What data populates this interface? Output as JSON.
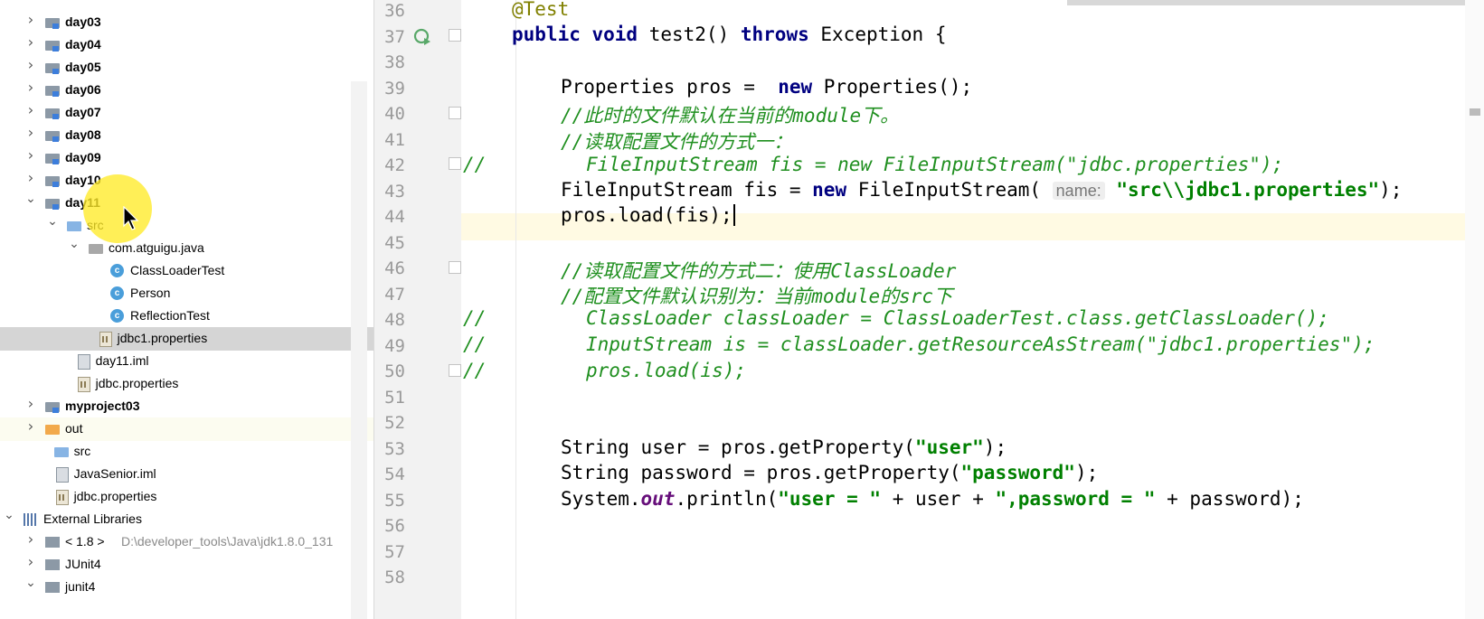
{
  "tree": [
    {
      "label": "day03",
      "bold": true,
      "indent": 0,
      "arrow": "right",
      "icon": "module-folder-icon"
    },
    {
      "label": "day04",
      "bold": true,
      "indent": 0,
      "arrow": "right",
      "icon": "module-folder-icon"
    },
    {
      "label": "day05",
      "bold": true,
      "indent": 0,
      "arrow": "right",
      "icon": "module-folder-icon"
    },
    {
      "label": "day06",
      "bold": true,
      "indent": 0,
      "arrow": "right",
      "icon": "module-folder-icon"
    },
    {
      "label": "day07",
      "bold": true,
      "indent": 0,
      "arrow": "right",
      "icon": "module-folder-icon"
    },
    {
      "label": "day08",
      "bold": true,
      "indent": 0,
      "arrow": "right",
      "icon": "module-folder-icon"
    },
    {
      "label": "day09",
      "bold": true,
      "indent": 0,
      "arrow": "right",
      "icon": "module-folder-icon"
    },
    {
      "label": "day10",
      "bold": true,
      "indent": 0,
      "arrow": "right",
      "icon": "module-folder-icon"
    },
    {
      "label": "day11",
      "bold": true,
      "indent": 0,
      "arrow": "down",
      "icon": "module-folder-icon"
    },
    {
      "label": "src",
      "bold": false,
      "indent": 1,
      "arrow": "down",
      "icon": "source-folder-icon"
    },
    {
      "label": "com.atguigu.java",
      "bold": false,
      "indent": 2,
      "arrow": "down",
      "icon": "package-icon"
    },
    {
      "label": "ClassLoaderTest",
      "bold": false,
      "indent": 3,
      "arrow": "",
      "icon": "java-class-icon"
    },
    {
      "label": "Person",
      "bold": false,
      "indent": 3,
      "arrow": "",
      "icon": "java-class-icon"
    },
    {
      "label": "ReflectionTest",
      "bold": false,
      "indent": 3,
      "arrow": "",
      "icon": "java-class-icon"
    },
    {
      "label": "jdbc1.properties",
      "bold": false,
      "indent": 2.4,
      "arrow": "",
      "icon": "properties-file-icon",
      "selected": true
    },
    {
      "label": "day11.iml",
      "bold": false,
      "indent": 1.4,
      "arrow": "",
      "icon": "iml-file-icon"
    },
    {
      "label": "jdbc.properties",
      "bold": false,
      "indent": 1.4,
      "arrow": "",
      "icon": "properties-file-icon"
    },
    {
      "label": "myproject03",
      "bold": true,
      "indent": 0,
      "arrow": "right",
      "icon": "module-folder-icon"
    },
    {
      "label": "out",
      "bold": false,
      "indent": 0,
      "arrow": "right",
      "icon": "excluded-folder-icon",
      "highlight": true
    },
    {
      "label": "src",
      "bold": false,
      "indent": 0.4,
      "arrow": "",
      "icon": "folder-icon"
    },
    {
      "label": "JavaSenior.iml",
      "bold": false,
      "indent": 0.4,
      "arrow": "",
      "icon": "iml-file-icon"
    },
    {
      "label": "jdbc.properties",
      "bold": false,
      "indent": 0.4,
      "arrow": "",
      "icon": "properties-file-icon"
    },
    {
      "label": "External Libraries",
      "bold": false,
      "indent": -1,
      "arrow": "down",
      "icon": "library-icon"
    },
    {
      "label": "< 1.8 >",
      "bold": false,
      "indent": 0,
      "arrow": "right",
      "icon": "jdk-icon",
      "hint": "D:\\developer_tools\\Java\\jdk1.8.0_131"
    },
    {
      "label": "JUnit4",
      "bold": false,
      "indent": 0,
      "arrow": "right",
      "icon": "jdk-icon"
    },
    {
      "label": "junit4",
      "bold": false,
      "indent": 0,
      "arrow": "down",
      "icon": "jdk-icon"
    }
  ],
  "editor": {
    "line_numbers": [
      "36",
      "37",
      "38",
      "39",
      "40",
      "41",
      "42",
      "43",
      "44",
      "45",
      "46",
      "47",
      "48",
      "49",
      "50",
      "51",
      "52",
      "53",
      "54",
      "55",
      "56",
      "57",
      "58"
    ],
    "gutter_comment": "//",
    "lines": {
      "l36_anno": "@Test",
      "l37_kw1": "public void ",
      "l37_name": "test2() ",
      "l37_kw2": "throws ",
      "l37_rest": "Exception {",
      "l39_a": "Properties pros =  ",
      "l39_kw": "new ",
      "l39_b": "Properties();",
      "l40": "//此时的文件默认在当前的module下。",
      "l41": "//读取配置文件的方式一：",
      "l42": "FileInputStream fis = new FileInputStream(\"jdbc.properties\");",
      "l43_a": "FileInputStream fis = ",
      "l43_kw": "new ",
      "l43_b": "FileInputStream( ",
      "l43_hint": "name:",
      "l43_str": " \"src\\\\jdbc1.properties\"",
      "l43_c": ");",
      "l44": "pros.load(fis);",
      "l46": "//读取配置文件的方式二：使用ClassLoader",
      "l47": "//配置文件默认识别为：当前module的src下",
      "l48": "ClassLoader classLoader = ClassLoaderTest.class.getClassLoader();",
      "l49": "InputStream is = classLoader.getResourceAsStream(\"jdbc1.properties\");",
      "l50": "pros.load(is);",
      "l53_a": "String user = pros.getProperty(",
      "l53_str": "\"user\"",
      "l53_b": ");",
      "l54_a": "String password = pros.getProperty(",
      "l54_str": "\"password\"",
      "l54_b": ");",
      "l55_a": "System.",
      "l55_out": "out",
      "l55_b": ".println(",
      "l55_s1": "\"user = \"",
      "l55_c": " + user + ",
      "l55_s2": "\",password = \"",
      "l55_d": " + password);"
    }
  }
}
